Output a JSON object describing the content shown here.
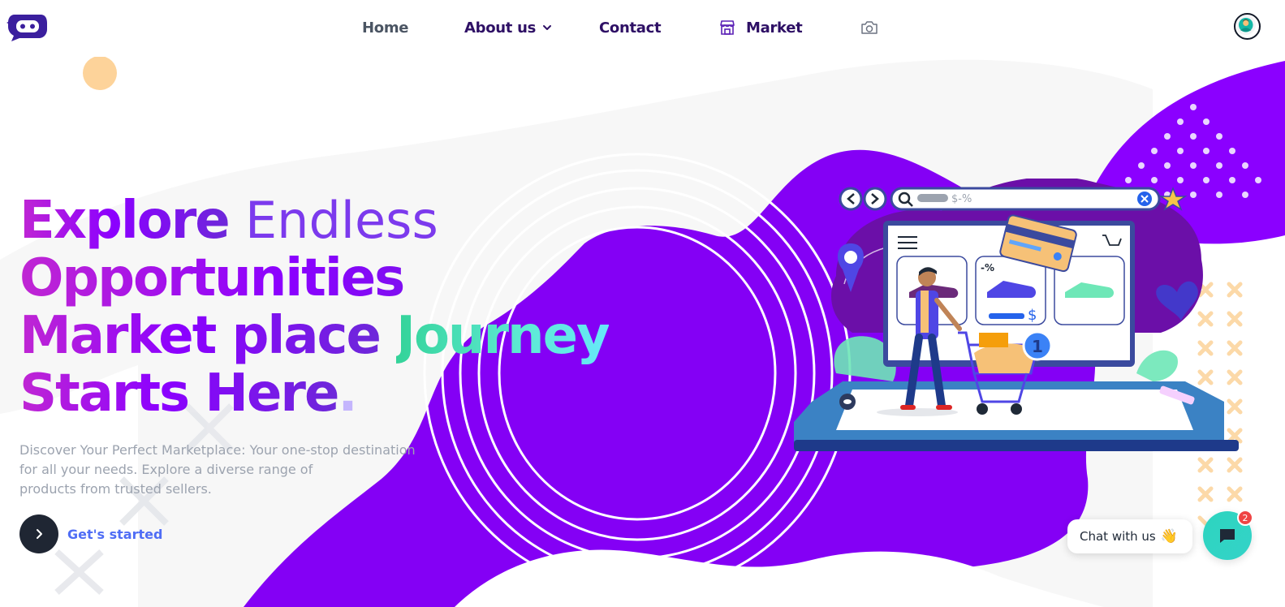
{
  "nav": {
    "items": [
      {
        "label": "Home"
      },
      {
        "label": "About us"
      },
      {
        "label": "Contact"
      },
      {
        "label": "Market"
      }
    ]
  },
  "hero": {
    "headline": {
      "word1": "Explore",
      "word2": "Endless",
      "line2": "Opportunities",
      "line3a": "Market place",
      "line3b": "Journey",
      "line4": "Starts Here",
      "period": "."
    },
    "description_lines": [
      "Discover Your Perfect Marketplace: Your one-stop destination",
      "for all your needs. Explore a diverse range of",
      "products from trusted sellers."
    ],
    "cta_label": "Get's started"
  },
  "illustration": {
    "search_text": "$-%",
    "discount_label": "-%",
    "cart_count": "1",
    "price_symbol": "$"
  },
  "chat": {
    "label": "Chat with us",
    "wave_emoji": "👋",
    "badge_count": "2"
  },
  "colors": {
    "primary_purple": "#8b00ff",
    "accent_teal": "#2dd4bf",
    "cta_blue": "#4f6df5",
    "dark": "#1f2633"
  },
  "icons": {
    "logo": "chat-bot-logo-icon",
    "about_dropdown": "chevron-down-icon",
    "market": "store-icon",
    "camera": "camera-icon",
    "avatar": "user-avatar-icon",
    "cta": "chevron-right-icon",
    "chat": "chat-bubble-icon"
  }
}
